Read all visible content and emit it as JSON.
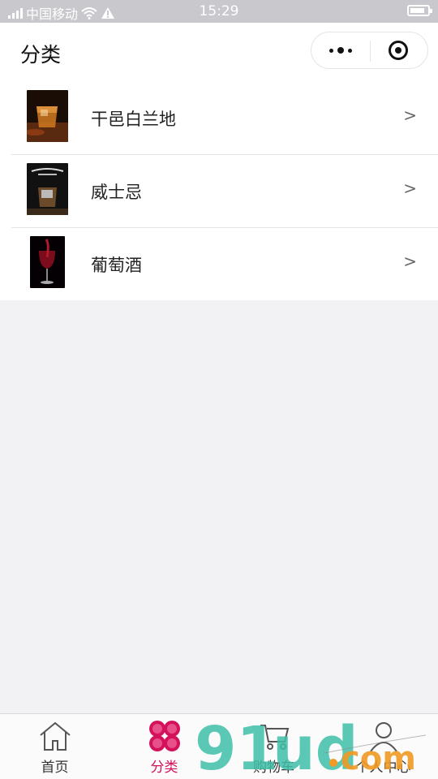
{
  "status_bar": {
    "carrier": "中国移动",
    "time": "15:29"
  },
  "header": {
    "title": "分类",
    "more_icon": "more-dots-icon",
    "close_icon": "target-circle-icon"
  },
  "categories": [
    {
      "label": "干邑白兰地",
      "arrow": ">",
      "thumb_icon": "brandy-glass-thumbnail"
    },
    {
      "label": "威士忌",
      "arrow": ">",
      "thumb_icon": "whiskey-bottle-thumbnail"
    },
    {
      "label": "葡萄酒",
      "arrow": ">",
      "thumb_icon": "red-wine-glass-thumbnail"
    }
  ],
  "tabbar": {
    "active_color": "#d3125b",
    "tabs": [
      {
        "label": "首页",
        "icon": "home-icon"
      },
      {
        "label": "分类",
        "icon": "clover-icon",
        "active": true
      },
      {
        "label": "购物车",
        "icon": "cart-icon"
      },
      {
        "label": "个人中心",
        "icon": "user-icon"
      }
    ]
  }
}
